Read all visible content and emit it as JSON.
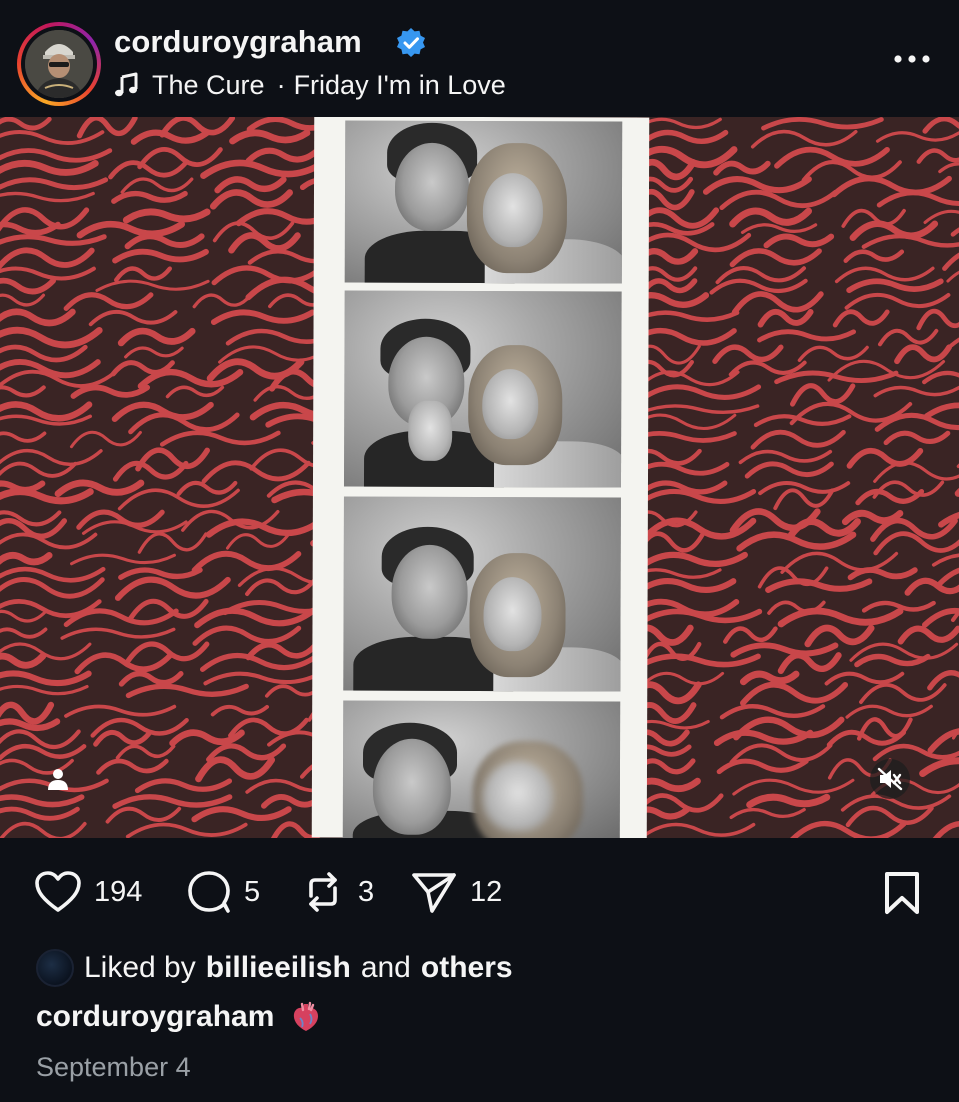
{
  "post": {
    "username": "corduroygraham",
    "verified": true,
    "music": {
      "artist": "The Cure",
      "separator": "·",
      "track": "Friday I'm in Love"
    }
  },
  "icons": {
    "more": "more-horizontal-icon",
    "music": "music-note-icon",
    "verified": "verified-badge-icon",
    "user_tag": "user-tag-icon",
    "mute": "speaker-muted-icon",
    "like": "heart-outline-icon",
    "comment": "comment-bubble-icon",
    "repost": "repost-arrows-icon",
    "share": "paper-plane-icon",
    "save": "bookmark-icon",
    "caption_emoji": "anatomical-heart-emoji"
  },
  "actions": {
    "likes": "194",
    "comments": "5",
    "reposts": "3",
    "shares": "12"
  },
  "liked_by": {
    "prefix": "Liked by",
    "user": "billieeilish",
    "middle": "and",
    "suffix": "others"
  },
  "caption": {
    "username": "corduroygraham"
  },
  "date": "September 4",
  "colors": {
    "background": "#0d1016",
    "verified_blue": "#3797f0",
    "pattern_red": "#c9474a",
    "pattern_bg": "#3a2424",
    "secondary_text": "#9aa0a6"
  }
}
